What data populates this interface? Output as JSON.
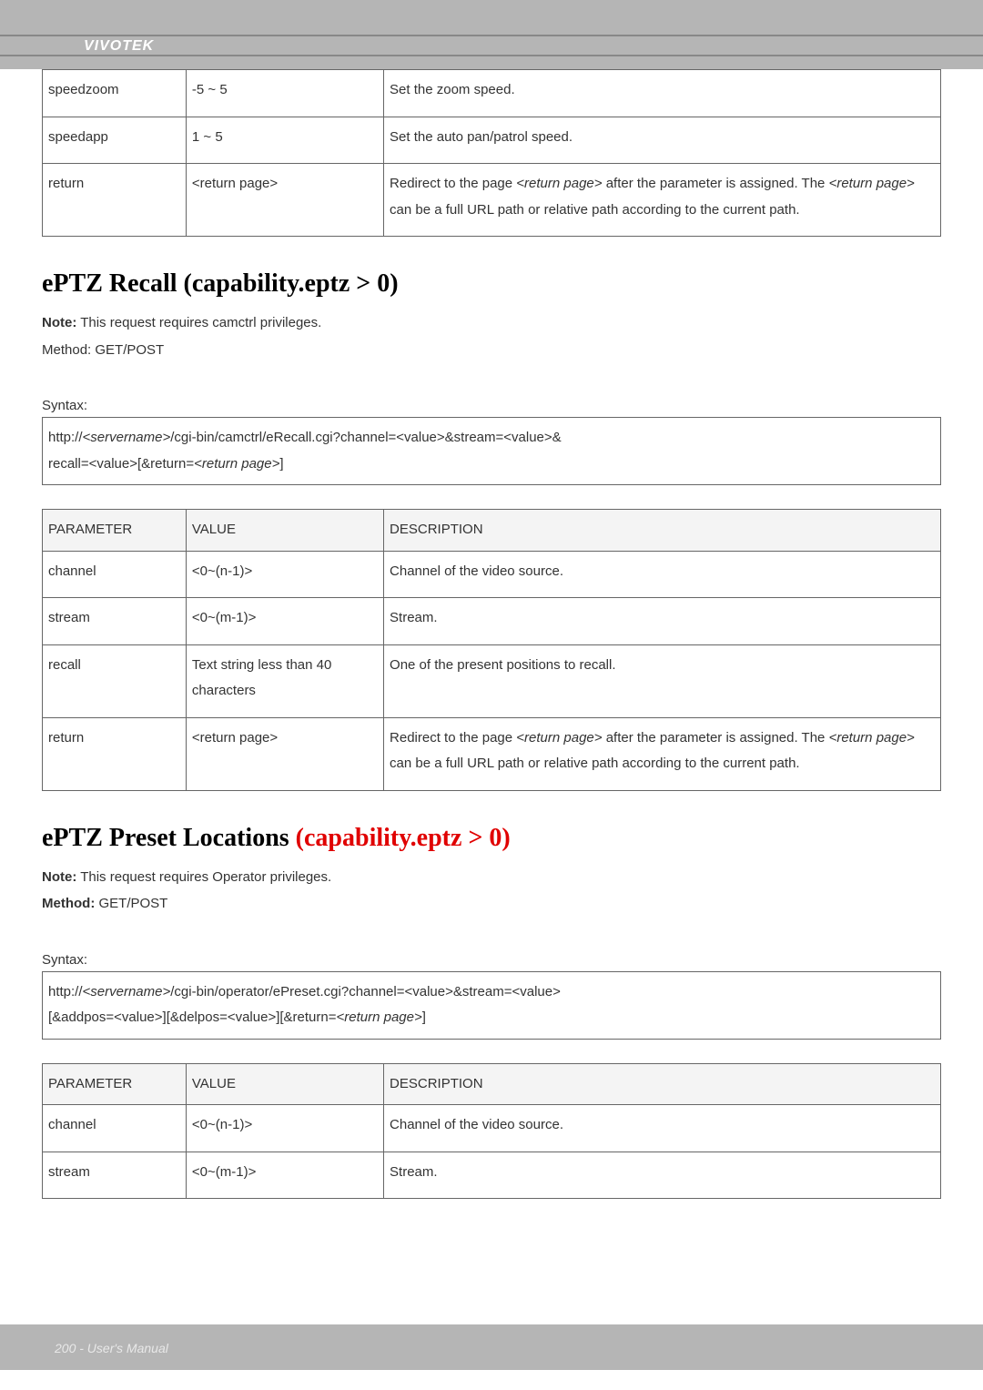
{
  "brand": "VIVOTEK",
  "footer": "200 - User's Manual",
  "topTable": {
    "rows": [
      {
        "param": "speedzoom",
        "value": "-5 ~ 5",
        "desc": "Set the zoom speed."
      },
      {
        "param": "speedapp",
        "value": "1 ~ 5",
        "desc": "Set the auto pan/patrol speed."
      },
      {
        "param": "return",
        "value": "<return page>",
        "desc_prefix": "Redirect to the page ",
        "desc_rp1": "<return page>",
        "desc_mid": " after the parameter is assigned. The ",
        "desc_rp2": "<return page>",
        "desc_suffix": " can be a full URL path or relative path according to the current path."
      }
    ]
  },
  "section1": {
    "title": "ePTZ Recall (capability.eptz > 0)",
    "noteLabel": "Note:",
    "noteText": " This request requires camctrl privileges.",
    "methodLine": "Method: GET/POST",
    "syntaxLabel": "Syntax:",
    "syntaxLine1a": "http://",
    "syntaxServer": "<servername>",
    "syntaxLine1b": "/cgi-bin/camctrl/eRecall.cgi?channel=<value>&stream=<value>&",
    "syntaxLine2a": "recall=<value>[&return=",
    "syntaxRP": "<return page>",
    "syntaxLine2b": "]",
    "headers": {
      "param": "PARAMETER",
      "value": "VALUE",
      "desc": "DESCRIPTION"
    },
    "rows": [
      {
        "param": "channel",
        "value": "<0~(n-1)>",
        "desc": "Channel of the video source."
      },
      {
        "param": "stream",
        "value": "<0~(m-1)>",
        "desc": "Stream."
      },
      {
        "param": "recall",
        "value": "Text string less than 40 characters",
        "desc": "One of the present positions to recall."
      },
      {
        "param": "return",
        "value": "<return page>",
        "desc_prefix": "Redirect to the page ",
        "desc_rp1": "<return page>",
        "desc_mid": " after the parameter is assigned. The ",
        "desc_rp2": "<return page>",
        "desc_suffix": " can be a full URL path or relative path according to the current path."
      }
    ]
  },
  "section2": {
    "titlePlain": "ePTZ Preset Locations ",
    "titleRed": "(capability.eptz > 0)",
    "noteLabel": "Note:",
    "noteText": " This request requires Operator privileges.",
    "methodLabel": "Method:",
    "methodText": " GET/POST",
    "syntaxLabel": "Syntax:",
    "syntaxLine1a": "http://",
    "syntaxServer": "<servername>",
    "syntaxLine1b": "/cgi-bin/operator/ePreset.cgi?channel=<value>&stream=<value>",
    "syntaxLine2a": "[&addpos=<value>][&delpos=<value>][&return=",
    "syntaxRP": "<return page>",
    "syntaxLine2b": "]",
    "headers": {
      "param": "PARAMETER",
      "value": "VALUE",
      "desc": "DESCRIPTION"
    },
    "rows": [
      {
        "param": "channel",
        "value": "<0~(n-1)>",
        "desc": "Channel of the video source."
      },
      {
        "param": "stream",
        "value": "<0~(m-1)>",
        "desc": "Stream."
      }
    ]
  }
}
